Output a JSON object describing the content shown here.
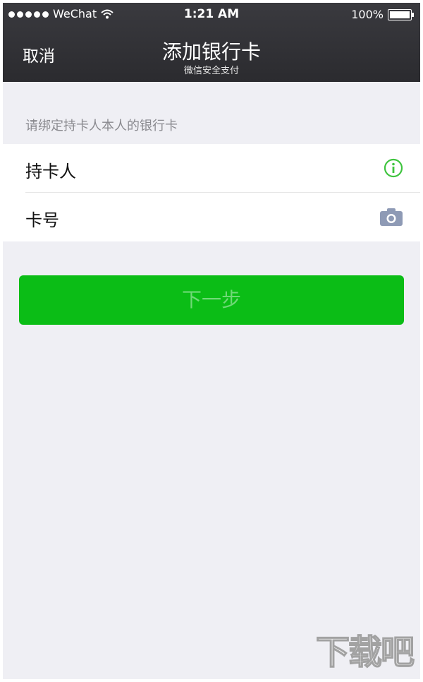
{
  "status_bar": {
    "carrier": "WeChat",
    "time": "1:21 AM",
    "battery": "100%"
  },
  "nav": {
    "cancel_label": "取消",
    "title": "添加银行卡",
    "subtitle": "微信安全支付"
  },
  "form": {
    "hint": "请绑定持卡人本人的银行卡",
    "rows": [
      {
        "label": "持卡人",
        "value": "",
        "icon": "info-icon"
      },
      {
        "label": "卡号",
        "value": "",
        "icon": "camera-icon"
      }
    ]
  },
  "next_button": {
    "label": "下一步"
  },
  "watermark": {
    "text": "下载吧"
  },
  "colors": {
    "header": "#2f2f33",
    "background": "#efeff4",
    "accent_green": "#0bbd16",
    "info_green": "#3fc43f",
    "camera_blue": "#8e9ab5"
  }
}
